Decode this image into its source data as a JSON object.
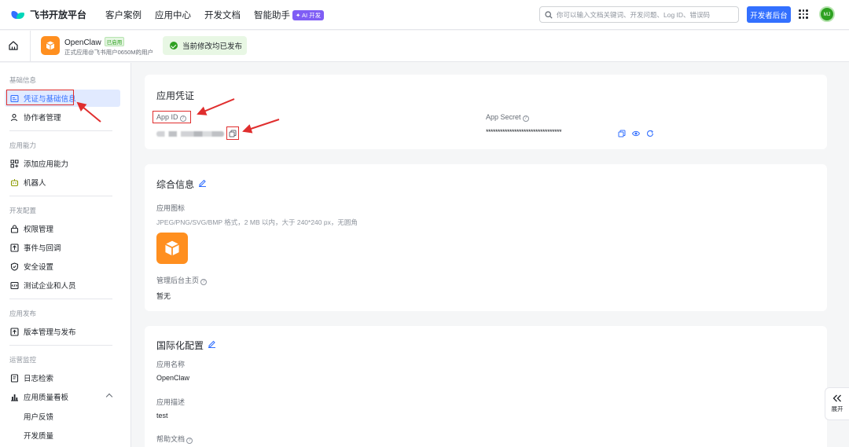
{
  "topbar": {
    "logo_text": "飞书开放平台",
    "nav": [
      "客户案例",
      "应用中心",
      "开发文档",
      "智能助手"
    ],
    "ai_badge": "✦ AI 开发",
    "search_placeholder": "你可以输入文档关键词、开发问题、Log ID、错误码",
    "dev_console_label": "开发者后台",
    "avatar_initials": "MJ"
  },
  "app_header": {
    "app_name": "OpenClaw",
    "app_status_tag": "已启用",
    "app_subtitle": "正式应用@飞书用户0650M的用户",
    "publish_status": "当前修改均已发布"
  },
  "sidebar": {
    "sections": [
      {
        "title": "基础信息",
        "items": [
          {
            "label": "凭证与基础信息",
            "icon": "credential-icon",
            "active": true
          },
          {
            "label": "协作者管理",
            "icon": "user-icon"
          }
        ]
      },
      {
        "title": "应用能力",
        "items": [
          {
            "label": "添加应用能力",
            "icon": "capability-icon"
          },
          {
            "label": "机器人",
            "icon": "robot-icon"
          }
        ]
      },
      {
        "title": "开发配置",
        "items": [
          {
            "label": "权限管理",
            "icon": "permission-icon"
          },
          {
            "label": "事件与回调",
            "icon": "event-icon"
          },
          {
            "label": "安全设置",
            "icon": "shield-icon"
          },
          {
            "label": "测试企业和人员",
            "icon": "test-icon"
          }
        ]
      },
      {
        "title": "应用发布",
        "items": [
          {
            "label": "版本管理与发布",
            "icon": "upload-icon"
          }
        ]
      },
      {
        "title": "运营监控",
        "items": [
          {
            "label": "日志检索",
            "icon": "log-icon"
          },
          {
            "label": "应用质量看板",
            "icon": "chart-icon",
            "expanded": true
          }
        ]
      }
    ],
    "sub_items": [
      "用户反馈",
      "开发质量"
    ]
  },
  "credentials_card": {
    "title": "应用凭证",
    "app_id_label": "App ID",
    "app_secret_label": "App Secret",
    "app_secret_masked": "********************************"
  },
  "general_card": {
    "title": "综合信息",
    "icon_label": "应用图标",
    "icon_hint": "JPEG/PNG/SVG/BMP 格式，2 MB 以内，大于 240*240 px，无圆角",
    "admin_home_label": "管理后台主页",
    "admin_home_value": "暂无"
  },
  "i18n_card": {
    "title": "国际化配置",
    "app_name_label": "应用名称",
    "app_name_value": "OpenClaw",
    "app_desc_label": "应用描述",
    "app_desc_value": "test",
    "help_doc_label": "帮助文档"
  },
  "expand_label": "展开",
  "colors": {
    "primary": "#3370ff",
    "app_orange": "#ff8f1f",
    "success_green": "#2ea121",
    "annotation_red": "#e02e2e"
  }
}
